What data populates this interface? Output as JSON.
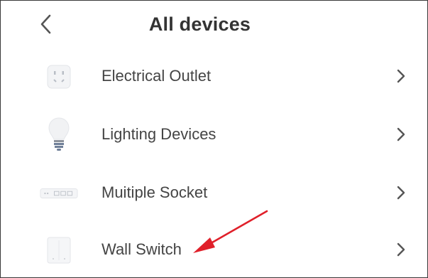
{
  "header": {
    "back_icon": "chevron-left-icon",
    "title": "All devices"
  },
  "devices": [
    {
      "label": "Electrical Outlet",
      "icon": "outlet-icon"
    },
    {
      "label": "Lighting Devices",
      "icon": "bulb-icon"
    },
    {
      "label": "Muitiple Socket",
      "icon": "power-strip-icon"
    },
    {
      "label": "Wall Switch",
      "icon": "wall-switch-icon"
    }
  ],
  "annotation": {
    "icon": "red-arrow-icon",
    "color": "#e0202a"
  },
  "colors": {
    "text": "#444444",
    "chevron": "#555555",
    "border": "#3a3a3a"
  }
}
